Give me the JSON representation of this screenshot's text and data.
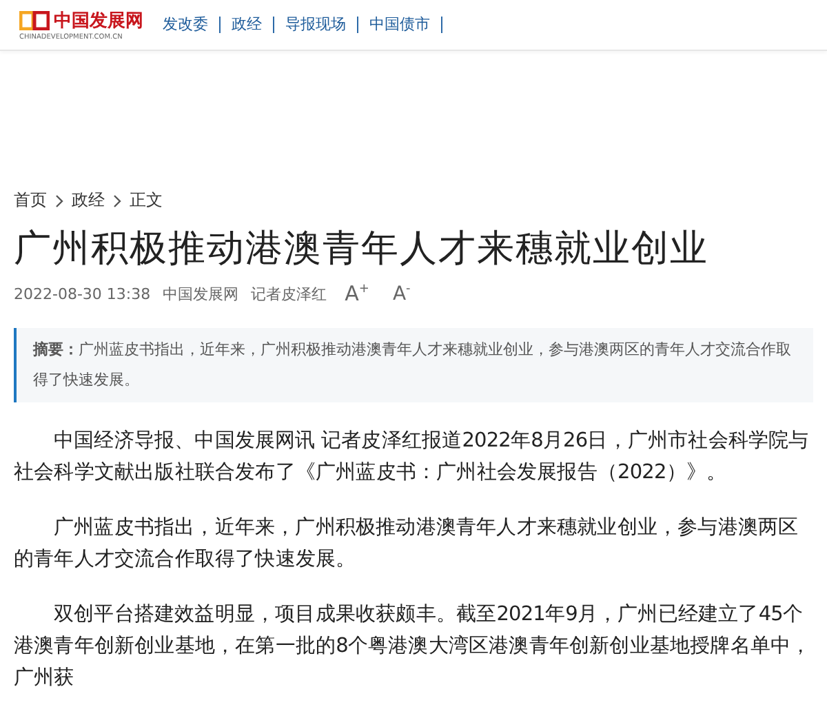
{
  "header": {
    "logo": {
      "name": "中国发展网",
      "domain": "CHINADEVELOPMENT.COM.CN"
    },
    "nav": [
      "发改委",
      "政经",
      "导报现场",
      "中国债市"
    ]
  },
  "breadcrumb": [
    "首页",
    "政经",
    "正文"
  ],
  "article": {
    "title": "广州积极推动港澳青年人才来穗就业创业",
    "date": "2022-08-30 13:38",
    "source": "中国发展网",
    "author": "记者皮泽红",
    "font_buttons": [
      {
        "kind": "increase",
        "label": "A",
        "mark": "+"
      },
      {
        "kind": "decrease",
        "label": "A",
        "mark": "-"
      }
    ],
    "summary": {
      "label": "摘要：",
      "text": "广州蓝皮书指出，近年来，广州积极推动港澳青年人才来穗就业创业，参与港澳两区的青年人才交流合作取得了快速发展。"
    },
    "paragraphs": [
      "中国经济导报、中国发展网讯  记者皮泽红报道2022年8月26日，广州市社会科学院与社会科学文献出版社联合发布了《广州蓝皮书：广州社会发展报告（2022）》。",
      "广州蓝皮书指出，近年来，广州积极推动港澳青年人才来穗就业创业，参与港澳两区的青年人才交流合作取得了快速发展。",
      "双创平台搭建效益明显，项目成果收获颇丰。截至2021年9月，广州已经建立了45个港澳青年创新创业基地，在第一批的8个粤港澳大湾区港澳青年创新创业基地授牌名单中，广州获"
    ]
  }
}
